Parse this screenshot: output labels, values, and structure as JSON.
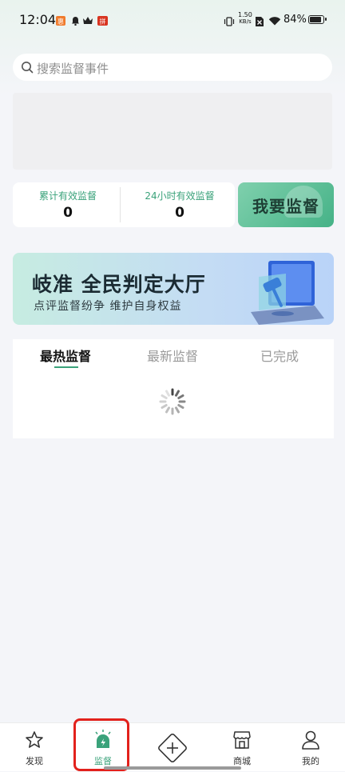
{
  "status_bar": {
    "time": "12:04",
    "net_speed_value": "1.50",
    "net_speed_unit": "KB/s",
    "battery": "84%"
  },
  "search": {
    "placeholder": "搜索监督事件"
  },
  "stats": {
    "cumulative_label": "累计有效监督",
    "cumulative_value": "0",
    "daily_label": "24小时有效监督",
    "daily_value": "0"
  },
  "supervise_button": {
    "label": "我要监督"
  },
  "promo": {
    "title": "岐准 全民判定大厅",
    "subtitle": "点评监督纷争 维护自身权益"
  },
  "tabs": [
    {
      "label": "最热监督",
      "active": true
    },
    {
      "label": "最新监督",
      "active": false
    },
    {
      "label": "已完成",
      "active": false
    }
  ],
  "bottom_nav": [
    {
      "label": "发现",
      "icon": "star-icon"
    },
    {
      "label": "监督",
      "icon": "alarm-icon",
      "active": true
    },
    {
      "label": "",
      "icon": "plus-diamond-icon"
    },
    {
      "label": "商城",
      "icon": "store-icon"
    },
    {
      "label": "我的",
      "icon": "user-icon"
    }
  ],
  "colors": {
    "accent": "#3aa27a",
    "highlight": "#e2211c"
  }
}
